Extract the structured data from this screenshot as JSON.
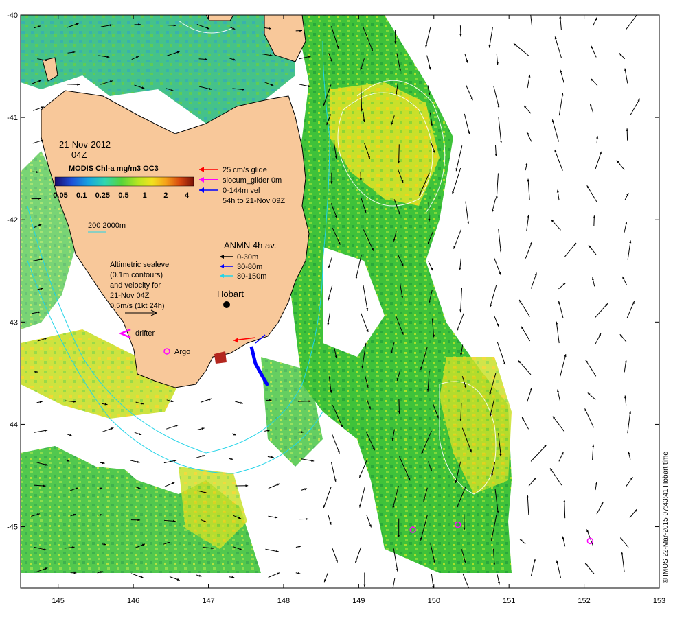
{
  "map": {
    "x_ticks": [
      "145",
      "146",
      "147",
      "148",
      "149",
      "150",
      "151",
      "152",
      "153"
    ],
    "y_ticks": [
      "-40",
      "-41",
      "-42",
      "-43",
      "-44",
      "-45"
    ],
    "lon_range": [
      144.5,
      153
    ],
    "lat_range": [
      -45.6,
      -40
    ],
    "credit": "© IMOS 22-Mar-2015 07:43:41 Hobart time",
    "colors": {
      "land": "#f8c89a",
      "coastline": "#000000",
      "ocean_nodata": "#ffffff",
      "bathy_contour": "#22d4e8",
      "sealevel_contour": "#ffffff",
      "velocity_arrow": "#000000",
      "glider_red": "#ff0000",
      "glider_magenta": "#ff00ff",
      "vel_blue": "#0000ff",
      "argo": "#ff00ff"
    }
  },
  "legend": {
    "date": "21-Nov-2012",
    "time": "04Z",
    "colorbar_title": "MODIS Chl-a mg/m3 OC3",
    "colorbar_ticks": [
      "0.05",
      "0.1",
      "0.25",
      "0.5",
      "1",
      "2",
      "4"
    ],
    "bathy_label": "200  2000m",
    "altimetry_lines": [
      "Altimetric sealevel",
      "(0.1m contours)",
      "and velocity for",
      "21-Nov 04Z",
      "0.5m/s (1kt 24h)"
    ],
    "drifter_label": "drifter",
    "argo_label": "Argo",
    "glider_lines": [
      "25 cm/s glide",
      "slocum_glider 0m",
      "0-144m vel",
      "54h to 21-Nov 09Z"
    ],
    "anmn_title": "ANMN 4h av.",
    "anmn_lines": [
      "0-30m",
      "30-80m",
      "80-150m"
    ],
    "city_label": "Hobart"
  },
  "chart_data": {
    "type": "map",
    "argo_floats": [
      {
        "lon": 149.72,
        "lat": -45.03
      },
      {
        "lon": 150.32,
        "lat": -44.98
      },
      {
        "lon": 152.08,
        "lat": -45.14
      }
    ],
    "hobart": {
      "lon": 147.33,
      "lat": -42.88
    }
  }
}
